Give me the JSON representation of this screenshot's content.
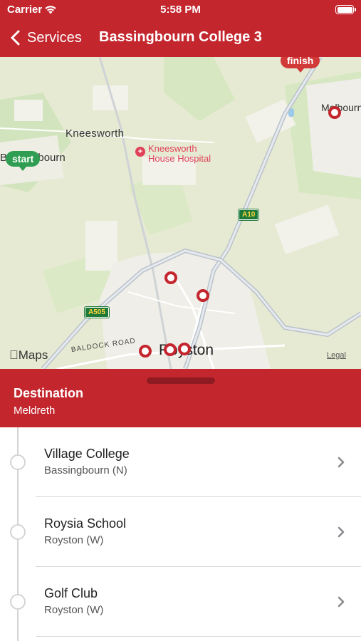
{
  "status_bar": {
    "carrier": "Carrier",
    "time": "5:58 PM"
  },
  "nav": {
    "back_label": "Services",
    "title": "Bassingbourn College 3"
  },
  "map": {
    "labels": {
      "kneesworth": "Kneesworth",
      "bassingbourn": "Bassingbourn",
      "hospital_line1": "Kneesworth",
      "hospital_line2": "House Hospital",
      "melbourn": "Melbourn",
      "royston": "Royston",
      "baldock_road": "BALDOCK ROAD",
      "a10": "A10",
      "a505": "A505"
    },
    "pins": {
      "start": "start",
      "finish": "finish"
    },
    "attribution": "Maps",
    "legal": "Legal"
  },
  "destination": {
    "label": "Destination",
    "value": "Meldreth"
  },
  "stops": [
    {
      "name": "Village College",
      "area": "Bassingbourn (N)"
    },
    {
      "name": "Roysia School",
      "area": "Royston (W)"
    },
    {
      "name": "Golf Club",
      "area": "Royston (W)"
    }
  ],
  "colors": {
    "brand_red": "#c4262e",
    "start_green": "#2f9e52",
    "map_bg": "#e9ecd9"
  }
}
